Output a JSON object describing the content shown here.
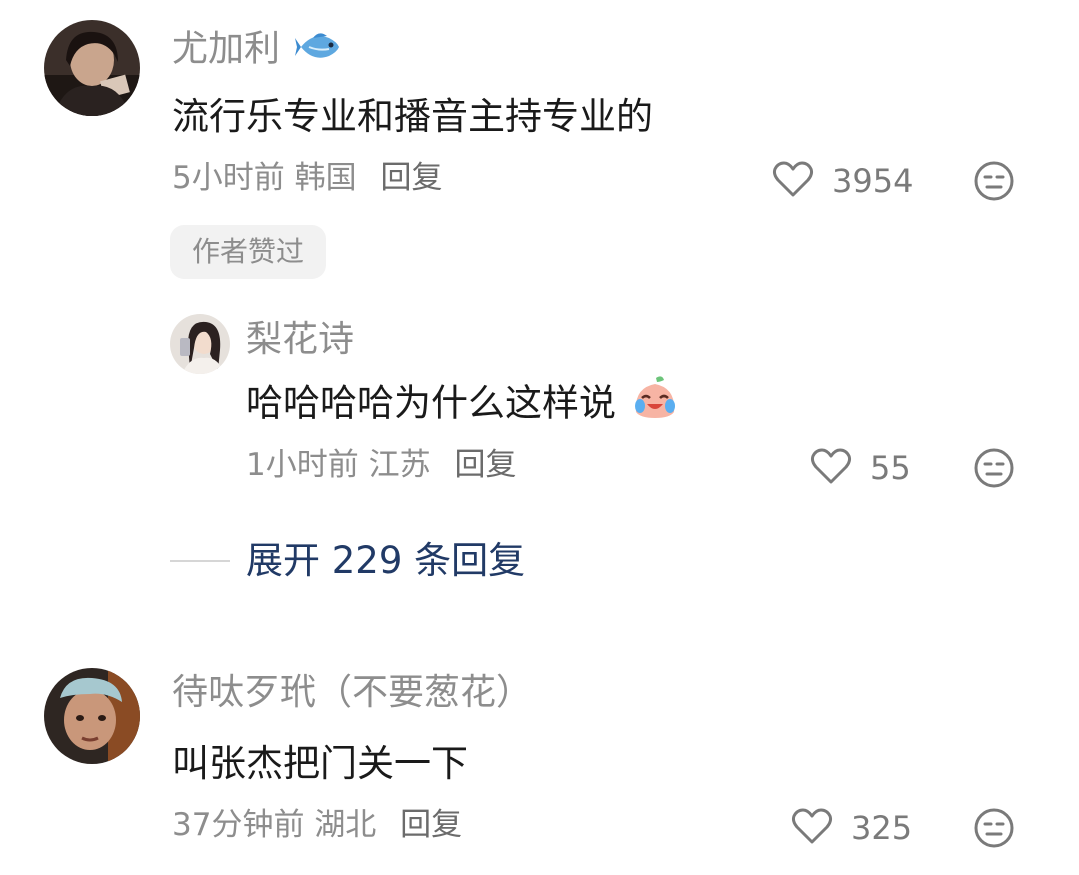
{
  "comments": [
    {
      "username": "尤加利",
      "badge_icon": "fish-emoji",
      "text": "流行乐专业和播音主持专业的",
      "time": "5小时前",
      "location": "韩国",
      "reply_label": "回复",
      "likes": "3954",
      "author_tag": "作者赞过",
      "replies": [
        {
          "username": "梨花诗",
          "text": "哈哈哈哈为什么这样说",
          "emoji": "crying-laughing-sticker",
          "time": "1小时前",
          "location": "江苏",
          "reply_label": "回复",
          "likes": "55"
        }
      ],
      "expand_label": "展开 229 条回复"
    },
    {
      "username": "待呔歹玳（不要葱花）",
      "text": "叫张杰把门关一下",
      "time": "37分钟前",
      "location": "湖北",
      "reply_label": "回复",
      "likes": "325"
    }
  ]
}
